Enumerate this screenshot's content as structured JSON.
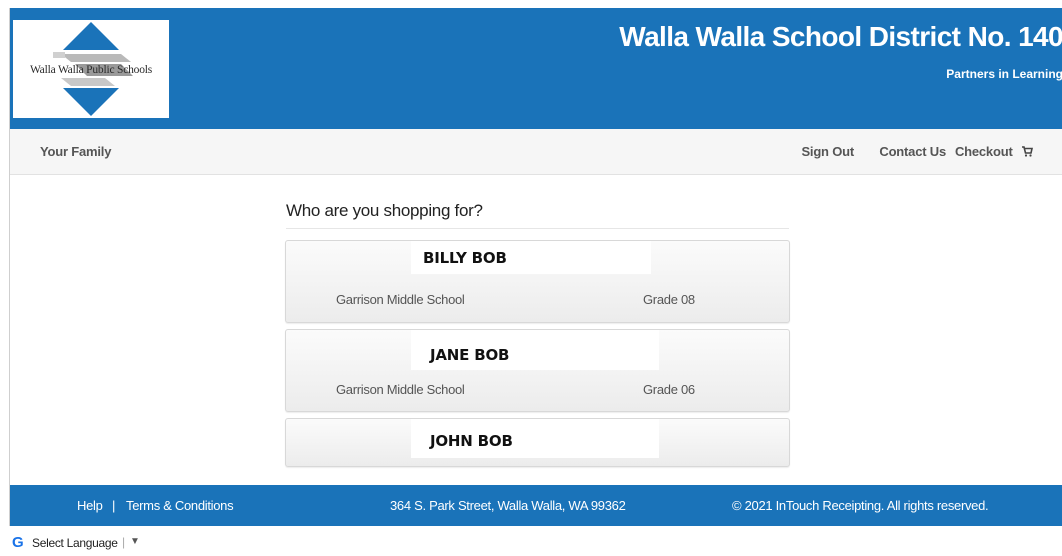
{
  "header": {
    "logo_text": "Walla Walla Public Schools",
    "title": "Walla Walla School District No. 140",
    "tagline": "Partners in Learning"
  },
  "nav": {
    "left_label": "Your Family",
    "sign_out": "Sign Out",
    "contact_us": "Contact Us",
    "checkout": "Checkout"
  },
  "main": {
    "question": "Who are you shopping for?",
    "students": [
      {
        "name": "BILLY BOB",
        "school": "Garrison Middle School",
        "grade": "Grade 08"
      },
      {
        "name": "JANE BOB",
        "school": "Garrison Middle School",
        "grade": "Grade 06"
      },
      {
        "name": "JOHN BOB"
      }
    ]
  },
  "footer": {
    "help": "Help",
    "separator": "|",
    "terms": "Terms & Conditions",
    "address": "364 S. Park Street, Walla Walla, WA 99362",
    "copyright": "© 2021 InTouch Receipting. All rights reserved."
  },
  "language": {
    "label": "Select Language",
    "separator": "|",
    "arrow": "▼"
  },
  "colors": {
    "brand_blue": "#1a73b9",
    "nav_bg": "#f6f6f6"
  },
  "icons": [
    "logo-mark",
    "cart-icon",
    "google-g-icon",
    "dropdown-arrow-icon"
  ]
}
